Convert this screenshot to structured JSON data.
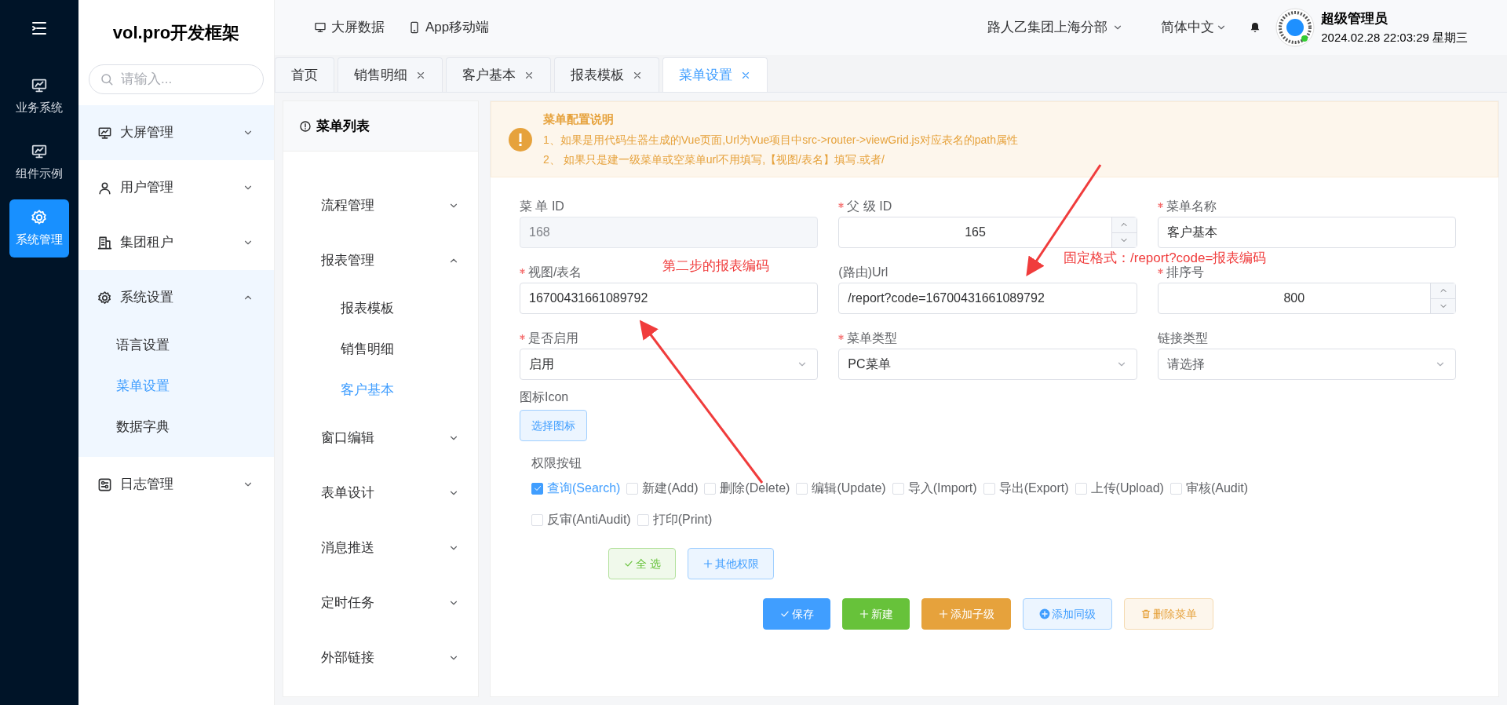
{
  "rail": {
    "items": [
      {
        "label": "业务系统",
        "selected": false
      },
      {
        "label": "组件示例",
        "selected": false
      },
      {
        "label": "系统管理",
        "selected": true
      }
    ]
  },
  "sidebar": {
    "title": "vol.pro开发框架",
    "search": {
      "placeholder": "请输入..."
    },
    "items": [
      {
        "label": "大屏管理",
        "expanded": false,
        "highlighted": true
      },
      {
        "label": "用户管理",
        "expanded": false,
        "highlighted": false
      },
      {
        "label": "集团租户",
        "expanded": false,
        "highlighted": false
      },
      {
        "label": "系统设置",
        "expanded": true,
        "highlighted": true,
        "children": [
          {
            "label": "语言设置",
            "selected": false
          },
          {
            "label": "菜单设置",
            "selected": true
          },
          {
            "label": "数据字典",
            "selected": false
          }
        ]
      },
      {
        "label": "日志管理",
        "expanded": false,
        "highlighted": false
      }
    ]
  },
  "header": {
    "links": [
      {
        "label": "大屏数据"
      },
      {
        "label": "App移动端"
      }
    ],
    "company": "路人乙集团上海分部",
    "language": "简体中文",
    "user": {
      "name": "超级管理员",
      "datetime": "2024.02.28 22:03:29 星期三"
    }
  },
  "tabs": [
    {
      "label": "首页",
      "closable": false,
      "selected": false
    },
    {
      "label": "销售明细",
      "closable": true,
      "selected": false
    },
    {
      "label": "客户基本",
      "closable": true,
      "selected": false
    },
    {
      "label": "报表模板",
      "closable": true,
      "selected": false
    },
    {
      "label": "菜单设置",
      "closable": true,
      "selected": true
    }
  ],
  "menu_list": {
    "title": "菜单列表",
    "items": [
      {
        "label": "流程管理",
        "expanded": false
      },
      {
        "label": "报表管理",
        "expanded": true,
        "children": [
          {
            "label": "报表模板",
            "selected": false
          },
          {
            "label": "销售明细",
            "selected": false
          },
          {
            "label": "客户基本",
            "selected": true
          }
        ]
      },
      {
        "label": "窗口编辑",
        "expanded": false
      },
      {
        "label": "表单设计",
        "expanded": false
      },
      {
        "label": "消息推送",
        "expanded": false
      },
      {
        "label": "定时任务",
        "expanded": false
      },
      {
        "label": "外部链接",
        "expanded": false
      }
    ]
  },
  "alert": {
    "title": "菜单配置说明",
    "lines": [
      "1、如果是用代码生器生成的Vue页面,Url为Vue项目中src->router->viewGrid.js对应表名的path属性",
      "2、 如果只是建一级菜单或空菜单url不用填写,【视图/表名】填写.或者/"
    ]
  },
  "form": {
    "fields": [
      {
        "label": "菜 单 ID",
        "kind": "text",
        "required": false,
        "disabled": true,
        "value": "168"
      },
      {
        "label": "父 级 ID",
        "kind": "number",
        "required": true,
        "disabled": false,
        "value": "165"
      },
      {
        "label": "菜单名称",
        "kind": "text",
        "required": true,
        "disabled": false,
        "value": "客户基本"
      },
      {
        "label": "视图/表名",
        "kind": "text",
        "required": true,
        "disabled": false,
        "value": "16700431661089792"
      },
      {
        "label": "(路由)Url",
        "kind": "text",
        "required": false,
        "disabled": false,
        "value": "/report?code=16700431661089792"
      },
      {
        "label": "排序号",
        "kind": "number",
        "required": true,
        "disabled": false,
        "value": "800"
      },
      {
        "label": "是否启用",
        "kind": "select",
        "required": true,
        "disabled": false,
        "value": "启用"
      },
      {
        "label": "菜单类型",
        "kind": "select",
        "required": true,
        "disabled": false,
        "value": "PC菜单"
      },
      {
        "label": "链接类型",
        "kind": "select",
        "required": false,
        "disabled": false,
        "placeholder": "请选择"
      }
    ],
    "icon_label": "图标Icon",
    "icon_button": "选择图标",
    "permissions_label": "权限按钮",
    "permissions": [
      {
        "label": "查询(Search)",
        "checked": true
      },
      {
        "label": "新建(Add)",
        "checked": false
      },
      {
        "label": "删除(Delete)",
        "checked": false
      },
      {
        "label": "编辑(Update)",
        "checked": false
      },
      {
        "label": "导入(Import)",
        "checked": false
      },
      {
        "label": "导出(Export)",
        "checked": false
      },
      {
        "label": "上传(Upload)",
        "checked": false
      },
      {
        "label": "审核(Audit)",
        "checked": false
      },
      {
        "label": "反审(AntiAudit)",
        "checked": false
      },
      {
        "label": "打印(Print)",
        "checked": false
      }
    ],
    "permission_buttons": [
      {
        "label": "全 选",
        "kind": "check-success"
      },
      {
        "label": "其他权限",
        "kind": "plus-primary"
      }
    ],
    "actions": [
      {
        "label": "保存",
        "kind": "save"
      },
      {
        "label": "新建",
        "kind": "new"
      },
      {
        "label": "添加子级",
        "kind": "child"
      },
      {
        "label": "添加同级",
        "kind": "sibling"
      },
      {
        "label": "删除菜单",
        "kind": "delete"
      }
    ]
  },
  "annotations": [
    {
      "text": "第二步的报表编码"
    },
    {
      "text": "固定格式：/report?code=报表编码"
    }
  ]
}
